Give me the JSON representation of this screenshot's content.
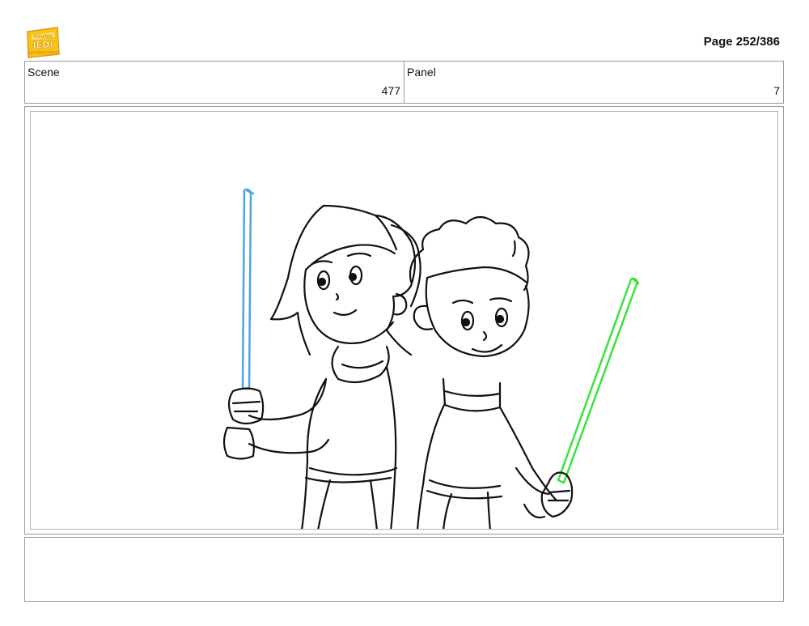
{
  "header": {
    "logo_text": "YOUNG JEDI ADVENTURES",
    "page_label": "Page 252/386"
  },
  "info": {
    "scene_label": "Scene",
    "scene_value": "477",
    "panel_label": "Panel",
    "panel_value": "7"
  },
  "notes": {
    "text": ""
  },
  "colors": {
    "logo_yellow": "#f5c518",
    "logo_orange": "#e39a12",
    "saber_blue": "#4aa6e0",
    "saber_green": "#3ae33a",
    "ink": "#111111",
    "border": "#9a9a9a"
  }
}
